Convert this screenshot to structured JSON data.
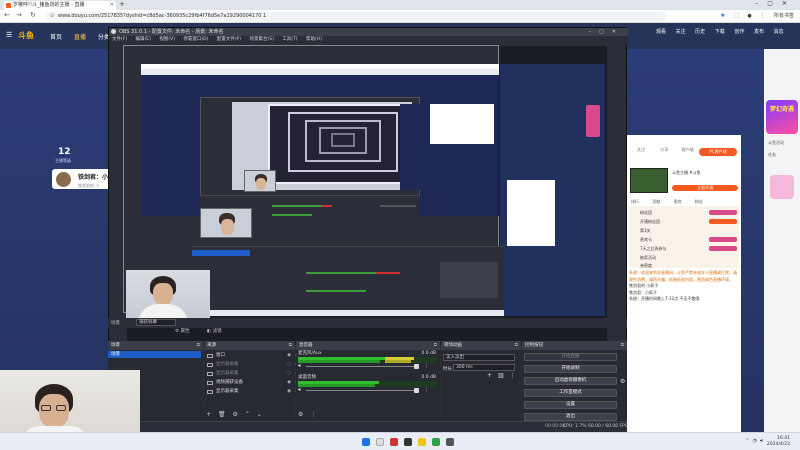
{
  "browser": {
    "tab_title": "岁嗷呼!!斗_猪鱼烧的主播 - 直播",
    "address": "www.douyu.com/2517835?dyshid=c8d5ac-360935c29fb4f76d5e7a19290004170 1",
    "profile_label": "所有书签"
  },
  "site": {
    "logo": "斗鱼",
    "nav": [
      "首页",
      "直播",
      "分类"
    ],
    "right_icons": [
      "观看",
      "关注",
      "历史",
      "下载",
      "创作",
      "发布",
      "消息"
    ],
    "count": "12",
    "count_label": "主播等级",
    "anchor_name": "铁剑君：小",
    "anchor_sub": "铁剑君的 小"
  },
  "right_panel": {
    "btn_label": "PC客户端",
    "icon_labels": [
      "关注",
      "分享",
      "客户端",
      "举报"
    ],
    "header_text": "斗鱼主播 #斗鱼",
    "orange_btn": "立即开通",
    "tabs": [
      "排行",
      "贡献",
      "贵宾",
      "粉丝"
    ],
    "rows": [
      "粉丝团",
      "开通粉丝团",
      "第3关",
      "贵宾卡",
      "7天之后再参与",
      "抽奖活动",
      "亲密度"
    ],
    "chat_lines": [
      "系统：欢迎来到本直播间，斗鱼严禁未成年人直播或打赏，请理性消费，谨防诈骗，抵制低俗内容，营造绿色直播环境。",
      "铁剑君的 小疯子",
      "铁剑君：小疯子",
      "系统：开播时间晚上7-12点 不见不散哦"
    ]
  },
  "far_right": {
    "promo": "梦幻奇遇",
    "labels": [
      "斗鱼活动",
      "任务",
      "礼物",
      "粉丝"
    ]
  },
  "obs": {
    "title": "OBS 31.0.1 - 配置文件: 未命名 - 场景: 未命名",
    "menu": [
      "文件(F)",
      "编辑(E)",
      "视图(V)",
      "停靠窗口(D)",
      "配置文件(P)",
      "场景集合(S)",
      "工具(T)",
      "帮助(H)"
    ],
    "status_row": {
      "label": "场景",
      "select": "捕获屏幕",
      "filter_label": "属性",
      "filter2_label": "滤镜"
    },
    "docks": {
      "scenes_title": "场景",
      "sources_title": "来源",
      "mixer_title": "混音器",
      "transitions_title": "转场动画",
      "controls_title": "控制按钮"
    },
    "scenes": [
      "场景"
    ],
    "sources": [
      "窗口",
      "显示器采集",
      "显示器采集",
      "视频捕获设备",
      "显示器采集"
    ],
    "mixer": [
      {
        "name": "麦克风/Aux",
        "db": "0.0 dB",
        "level_pct": 83
      },
      {
        "name": "桌面音频",
        "db": "0.0 dB",
        "level_pct": 58
      }
    ],
    "transitions": {
      "type": "淡入淡出",
      "duration_label": "时长",
      "duration": "300 ms"
    },
    "controls": [
      "开始直播",
      "开始录制",
      "启动虚拟摄像机",
      "工作室模式",
      "设置",
      "退出"
    ],
    "statusbar": {
      "rec": "00:00:00",
      "cpu": "CPU: 1.7%",
      "fps": "60.00 / 60.00 FPS"
    }
  },
  "taskbar": {
    "time": "16:41",
    "date": "2024/4/23"
  }
}
